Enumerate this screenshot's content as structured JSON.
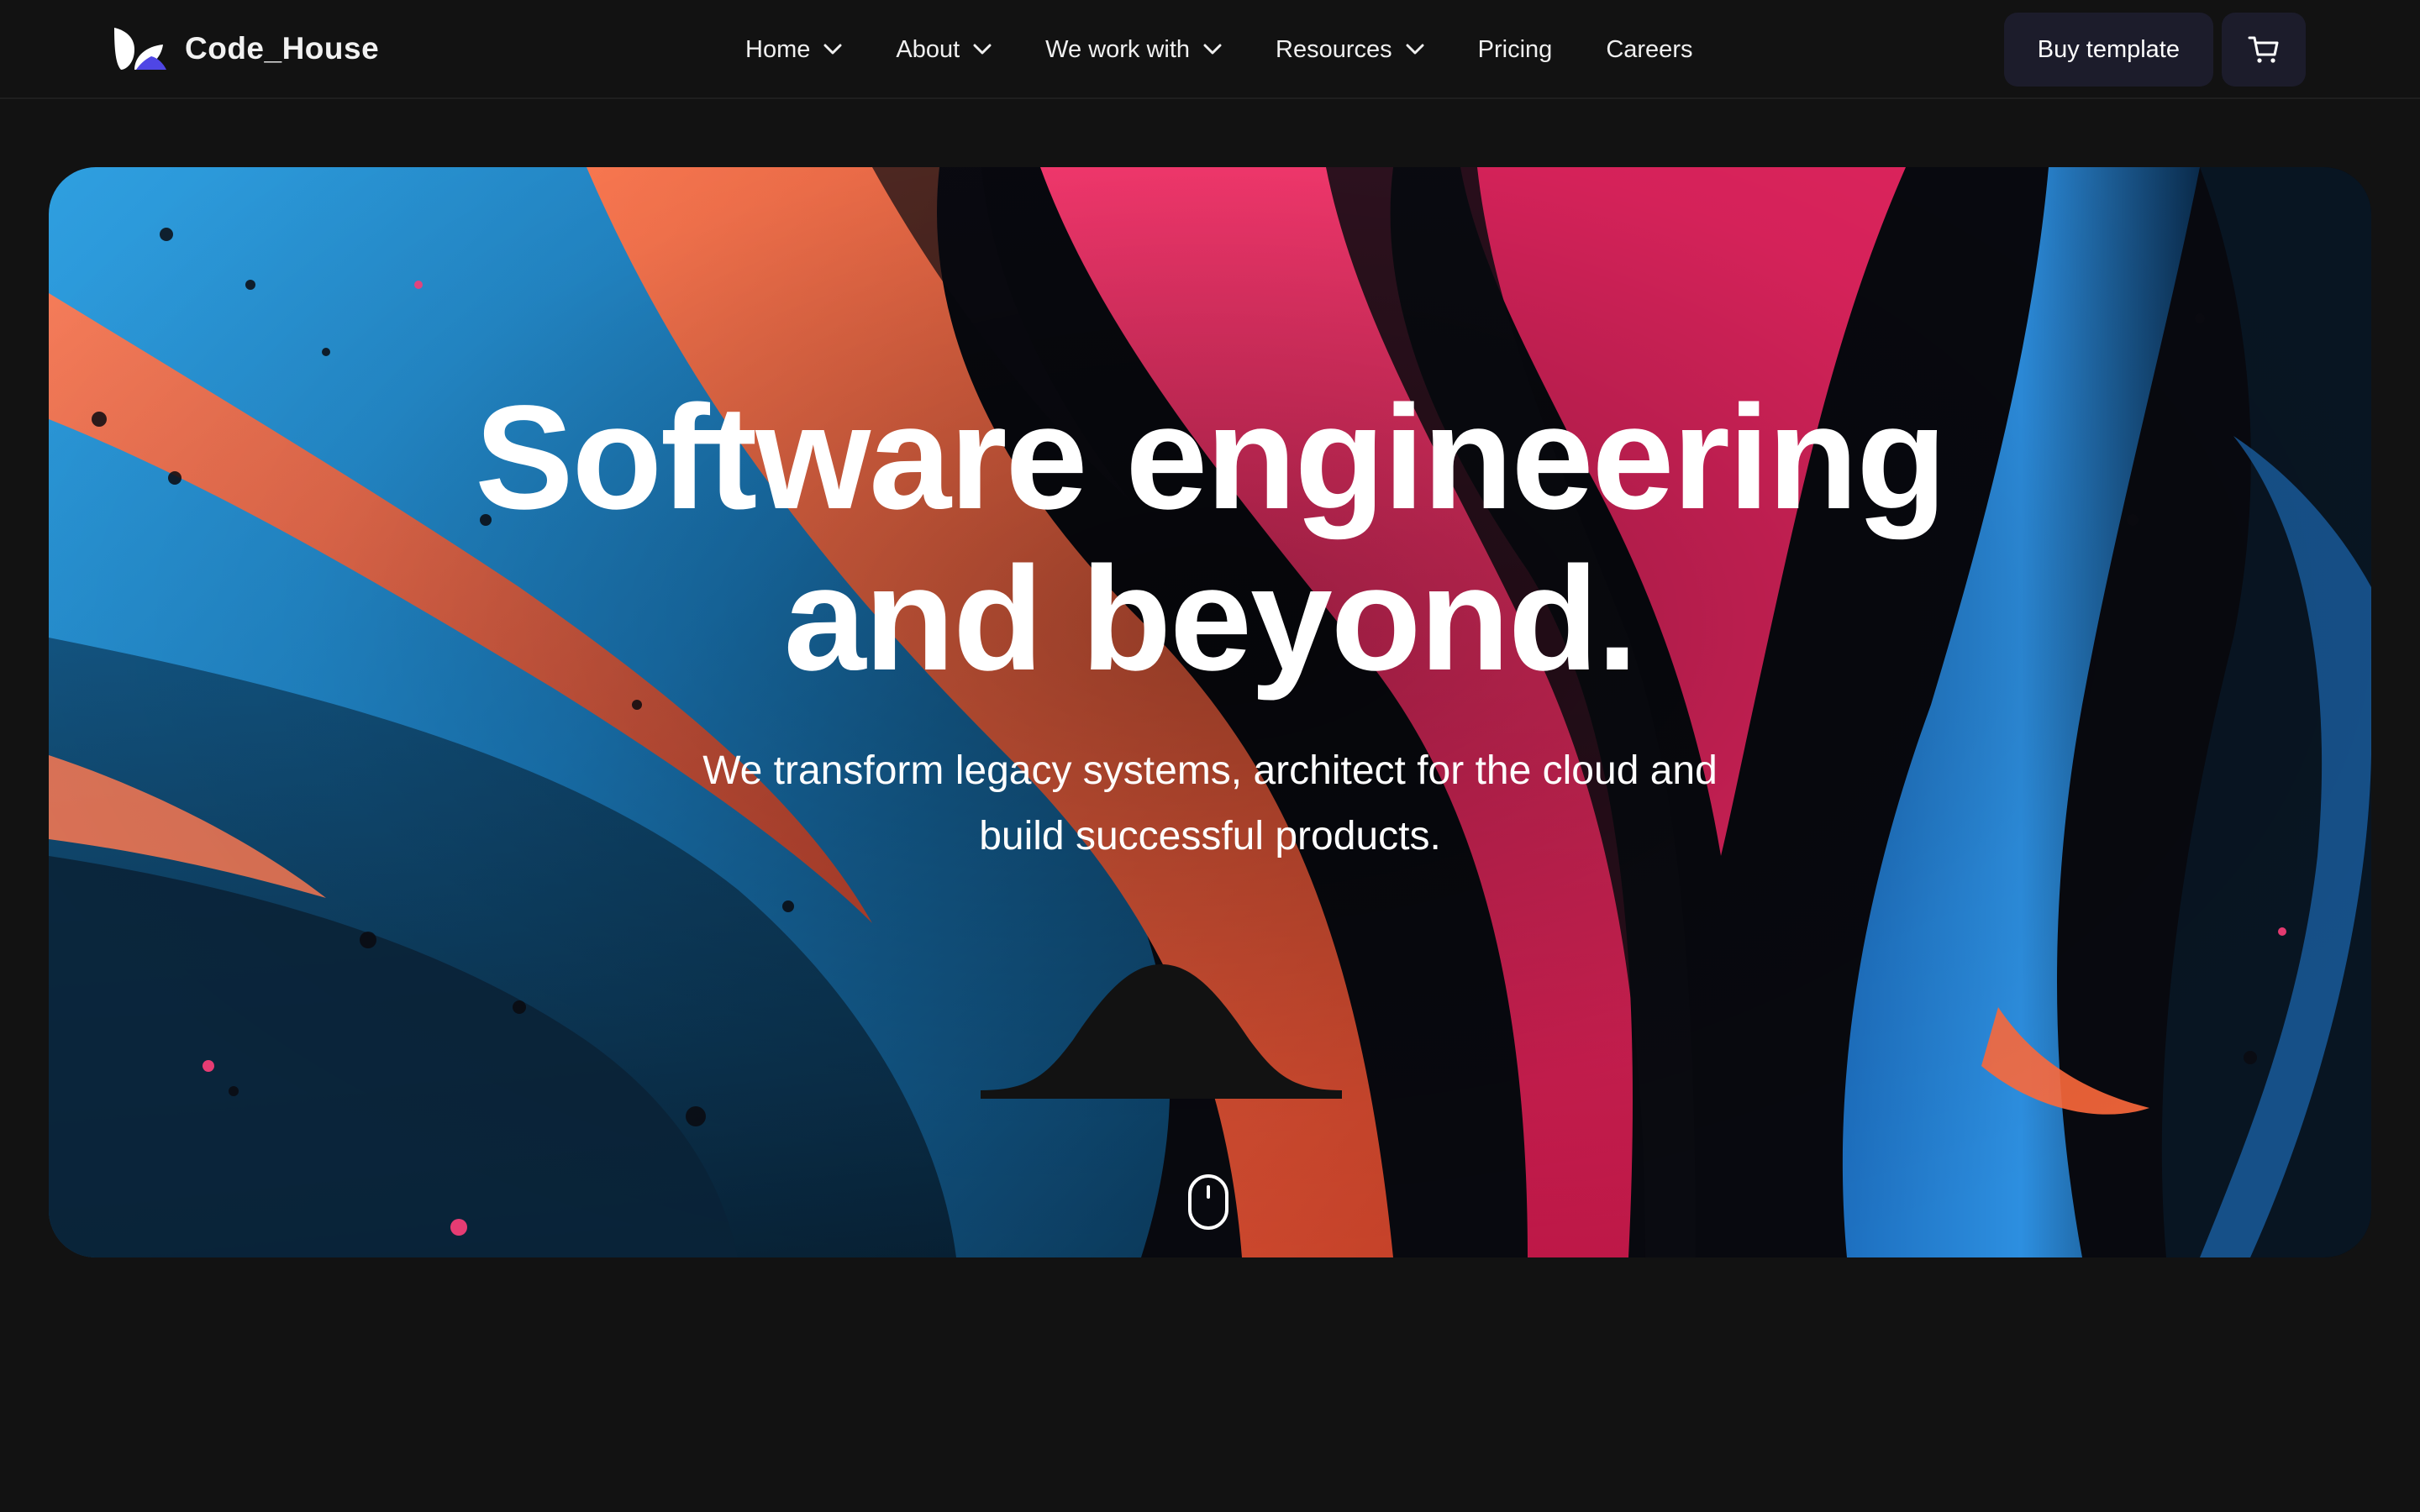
{
  "brand": {
    "name": "Code_House"
  },
  "nav": {
    "items": [
      {
        "label": "Home",
        "has_dropdown": true
      },
      {
        "label": "About",
        "has_dropdown": true
      },
      {
        "label": "We work with",
        "has_dropdown": true
      },
      {
        "label": "Resources",
        "has_dropdown": true
      },
      {
        "label": "Pricing",
        "has_dropdown": false
      },
      {
        "label": "Careers",
        "has_dropdown": false
      }
    ],
    "buy_label": "Buy template",
    "cart_icon": "cart-icon"
  },
  "hero": {
    "title_line1": "Software engineering",
    "title_line2": "and beyond.",
    "subtitle_line1": "We transform legacy systems, architect for the cloud and",
    "subtitle_line2": "build successful products.",
    "scroll_icon": "mouse-icon"
  },
  "colors": {
    "background": "#121212",
    "button_bg": "#1c1c2b",
    "logo_accent": "#4f46e5",
    "text": "#ffffff"
  }
}
